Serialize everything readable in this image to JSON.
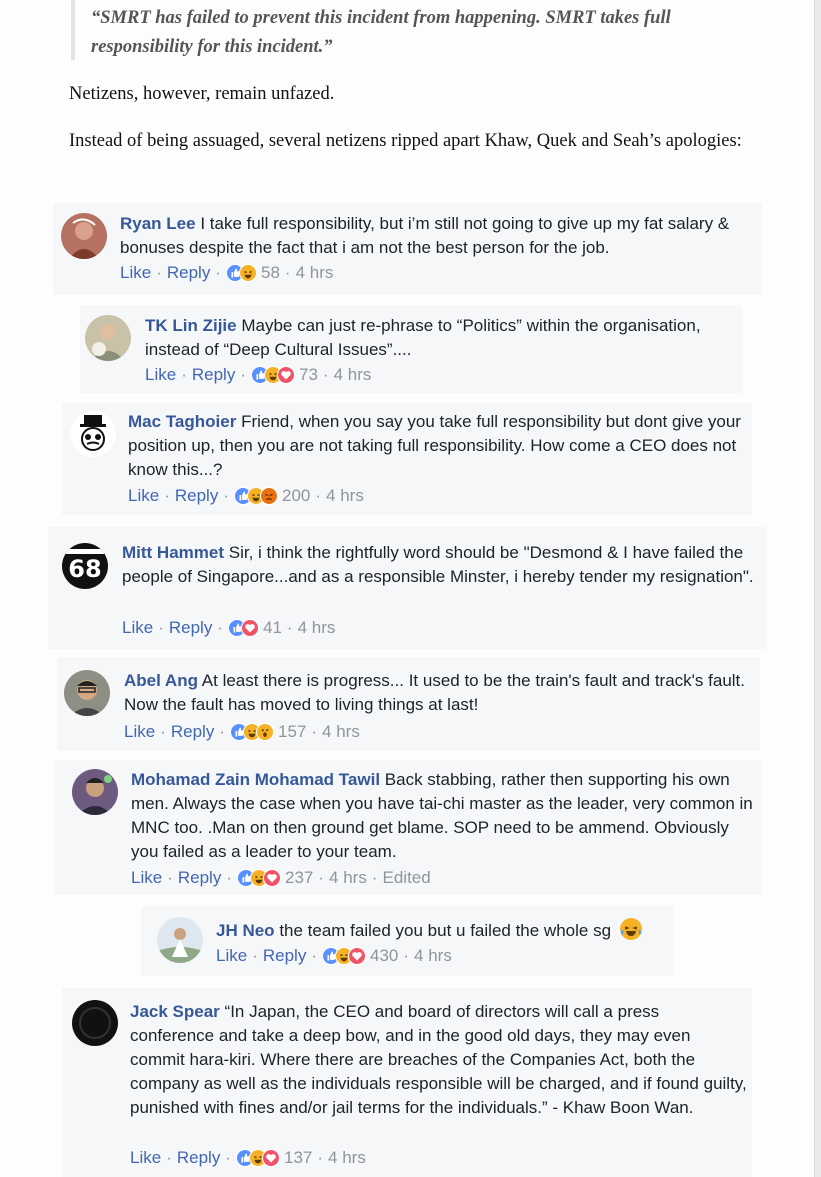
{
  "article": {
    "quote": "“SMRT has failed to prevent this incident from happening. SMRT takes full responsibility for this incident.”",
    "para1": "Netizens, however, remain unfazed.",
    "para2": "Instead of being assuaged, several netizens ripped apart Khaw, Quek and Seah’s apologies:"
  },
  "labels": {
    "like": "Like",
    "reply": "Reply",
    "dot": "·"
  },
  "comments": [
    {
      "name": "Ryan Lee",
      "text": "I take full responsibility, but i’m still not going to give up my fat salary & bonuses despite the fact that i am not the best person for the job.",
      "reactions": [
        "like",
        "haha"
      ],
      "count": "58",
      "time": "4 hrs"
    },
    {
      "name": "TK Lin Zijie",
      "text": "Maybe can just re-phrase to “Politics” within the organisation, instead of “Deep Cultural Issues”....",
      "reactions": [
        "like",
        "haha",
        "love"
      ],
      "count": "73",
      "time": "4 hrs"
    },
    {
      "name": "Mac Taghoier",
      "text": "Friend, when you say you take full responsibility but dont give your position up, then you are not taking full responsibility. How come a CEO does not know this...?",
      "reactions": [
        "like",
        "haha",
        "angry"
      ],
      "count": "200",
      "time": "4 hrs"
    },
    {
      "name": "Mitt Hammet",
      "text": "Sir, i think the rightfully word should be \"Desmond & I have failed the people of Singapore...and as a responsible Minster, i hereby tender my resignation\".",
      "reactions": [
        "like",
        "love"
      ],
      "count": "41",
      "time": "4 hrs"
    },
    {
      "name": "Abel Ang",
      "text": "At least there is progress... It used to be the train's fault and track's fault. Now the fault has moved to living things at last!",
      "reactions": [
        "like",
        "haha",
        "wow"
      ],
      "count": "157",
      "time": "4 hrs"
    },
    {
      "name": "Mohamad Zain Mohamad Tawil",
      "text": "Back stabbing, rather then supporting his own men. Always the case when you have tai-chi master as the leader, very common in MNC too. .Man on then ground get blame. SOP need to be ammend. Obviously you failed as a leader to your team.",
      "reactions": [
        "like",
        "haha",
        "love"
      ],
      "count": "237",
      "time": "4 hrs",
      "edited": "Edited"
    },
    {
      "name": "JH Neo",
      "text": "the team failed you but u failed the whole sg",
      "reactions": [
        "like",
        "haha",
        "love"
      ],
      "count": "430",
      "time": "4 hrs"
    },
    {
      "name": "Jack Spear",
      "text": "“In Japan, the CEO and board of directors will call a press conference and take a deep bow, and in the good old days, they may even commit hara-kiri. Where there are breaches of the Companies Act, both the company as well as the individuals responsible will be charged, and if found guilty, punished with fines and/or jail terms for the individuals.” - Khaw Boon Wan.",
      "reactions": [
        "like",
        "haha",
        "love"
      ],
      "count": "137",
      "time": "4 hrs"
    }
  ],
  "colors": {
    "name": "#365899",
    "link": "#4267b2",
    "meta": "#90949c",
    "card": "#f6f7f9"
  },
  "icons": {
    "like": "thumbs-up-icon",
    "haha": "laughing-face-icon",
    "love": "heart-icon",
    "angry": "angry-face-icon",
    "wow": "wow-face-icon",
    "emoji": "tears-of-joy-emoji-icon"
  }
}
